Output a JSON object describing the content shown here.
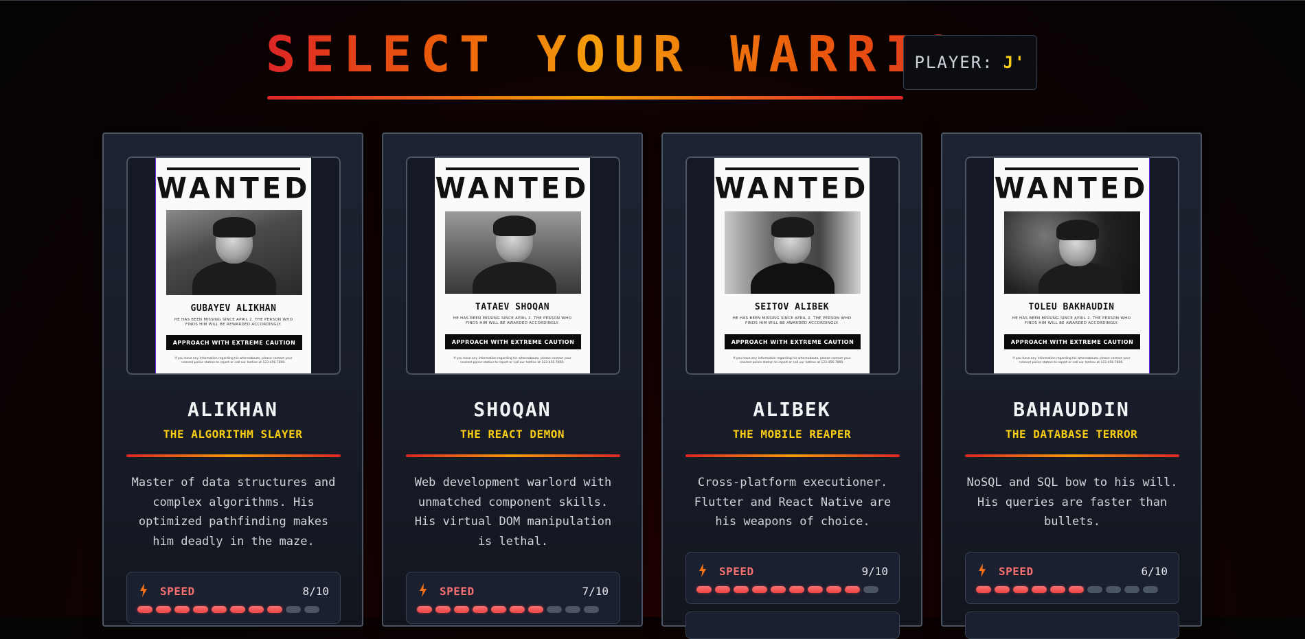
{
  "header": {
    "title": "SELECT YOUR WARRIOR",
    "player_label": "PLAYER:",
    "player_value": "J'"
  },
  "colors": {
    "accent_red": "#dc2626",
    "accent_gold": "#facc15",
    "stat_red": "#f87171",
    "card_bg": "#1d2331"
  },
  "poster": {
    "heading": "WANTED",
    "caution": "APPROACH WITH EXTREME CAUTION",
    "missing_text": "HE HAS BEEN MISSING SINCE APRIL 2. THE PERSON WHO FINDS HIM WILL BE AWARDED ACCORDINGLY.",
    "info_text": "If you have any information regarding his whereabouts, please contact your nearest police station to report or call our hotline at 123-456-7890."
  },
  "warriors": [
    {
      "poster_name": "GUBAYEV ALIKHAN",
      "poster_missing": "HE HAS BEEN MISSING SINCE APRIL 2. THE PERSON WHO FINDS HIM WILL BE REWARDED ACCORDINGLY.",
      "name": "ALIKHAN",
      "title": "THE ALGORITHM SLAYER",
      "description": "Master of data structures and complex algorithms. His optimized pathfinding makes him deadly in the maze.",
      "stat_label": "SPEED",
      "stat_value": "8/10",
      "stat_level": 8
    },
    {
      "poster_name": "TATAEV SHOQAN",
      "poster_missing": "HE HAS BEEN MISSING SINCE APRIL 2. THE PERSON WHO FINDS HIM WILL BE AWARDED ACCORDINGLY.",
      "name": "SHOQAN",
      "title": "THE REACT DEMON",
      "description": "Web development warlord with unmatched component skills. His virtual DOM manipulation is lethal.",
      "stat_label": "SPEED",
      "stat_value": "7/10",
      "stat_level": 7
    },
    {
      "poster_name": "SEITOV ALIBEK",
      "poster_missing": "HE HAS BEEN MISSING SINCE APRIL 2. THE PERSON WHO FINDS HIM WILL BE AWARDED ACCORDINGLY.",
      "name": "ALIBEK",
      "title": "THE MOBILE REAPER",
      "description": "Cross-platform executioner. Flutter and React Native are his weapons of choice.",
      "stat_label": "SPEED",
      "stat_value": "9/10",
      "stat_level": 9
    },
    {
      "poster_name": "TOLEU BAKHAUDIN",
      "poster_missing": "HE HAS BEEN MISSING SINCE APRIL 2. THE PERSON WHO FINDS HIM WILL BE AWARDED ACCORDINGLY.",
      "name": "BAHAUDDIN",
      "title": "THE DATABASE TERROR",
      "description": "NoSQL and SQL bow to his will. His queries are faster than bullets.",
      "stat_label": "SPEED",
      "stat_value": "6/10",
      "stat_level": 6
    }
  ]
}
